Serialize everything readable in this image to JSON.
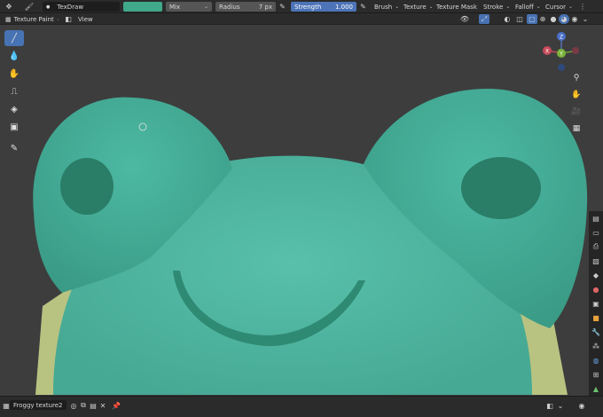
{
  "topbar": {
    "brush_name": "TexDraw",
    "blend_mode": "Mix",
    "radius_label": "Radius",
    "radius_value": "7 px",
    "strength_label": "Strength",
    "strength_value": "1.000",
    "menus": [
      "Brush",
      "Texture",
      "Texture Mask",
      "Stroke",
      "Falloff",
      "Cursor"
    ],
    "brush_color": "#3fa98a"
  },
  "header": {
    "mode": "Texture Paint",
    "view_menu": "View"
  },
  "gizmo": {
    "z": "Z",
    "x": "X",
    "y": "Y"
  },
  "bottombar": {
    "image_name": "Froggy texture2"
  },
  "tools": [
    "brush-tool",
    "soften-tool",
    "smear-tool",
    "clone-tool",
    "fill-tool",
    "mask-tool",
    "annotate-tool"
  ],
  "colors": {
    "active_tool": "#4772b3",
    "strength_slider": "#4d74b8",
    "frog_body": "#4fb6a2",
    "frog_eye_patch": "#2a7d66",
    "frog_mouth": "#2f8a73",
    "frog_underbelly": "#b9c381"
  }
}
